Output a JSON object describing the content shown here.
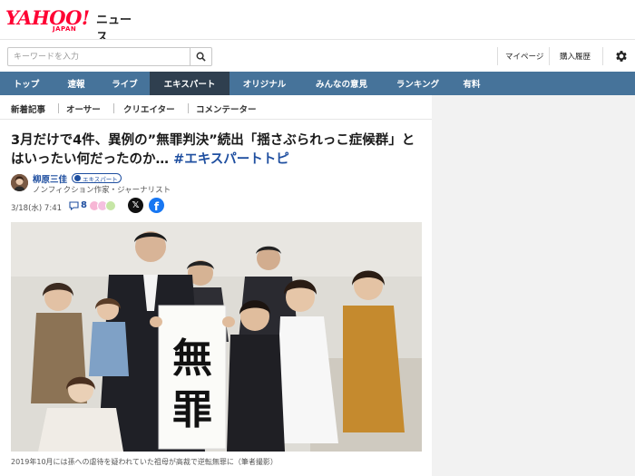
{
  "header": {
    "logo_text": "YAHOO!",
    "logo_sub": "JAPAN",
    "service_name": "ニュース"
  },
  "search": {
    "placeholder": "キーワードを入力",
    "value": ""
  },
  "utility_links": [
    "マイページ",
    "購入履歴"
  ],
  "nav": {
    "items": [
      "トップ",
      "速報",
      "ライブ",
      "エキスパート",
      "オリジナル",
      "みんなの意見",
      "ランキング",
      "有料"
    ],
    "active": "エキスパート"
  },
  "subnav": {
    "items": [
      "新着記事",
      "オーサー",
      "クリエイター",
      "コメンテーター"
    ]
  },
  "article": {
    "title": "3月だけで4件、異例の”無罪判決”続出「揺さぶられっこ症候群」とはいったい何だったのか…",
    "hashtag": "#エキスパートトピ",
    "author_name": "柳原三佳",
    "author_badge": "エキスパート",
    "author_role": "ノンフィクション作家・ジャーナリスト",
    "date": "3/18(水) 7:41",
    "comment_count": "8",
    "photo_text": "無罪",
    "caption": "2019年10月には孫への虐待を疑われていた祖母が高裁で逆転無罪に（筆者撮影）"
  },
  "icons": {
    "search": "search-icon",
    "settings": "gear-icon",
    "comment": "comment-icon",
    "share_x": "x-icon",
    "share_facebook": "facebook-icon"
  },
  "colors": {
    "brand_red": "#ff0033",
    "nav_bg": "#46739a",
    "nav_active": "#2f3f4f",
    "link_blue": "#1f4fa0"
  }
}
